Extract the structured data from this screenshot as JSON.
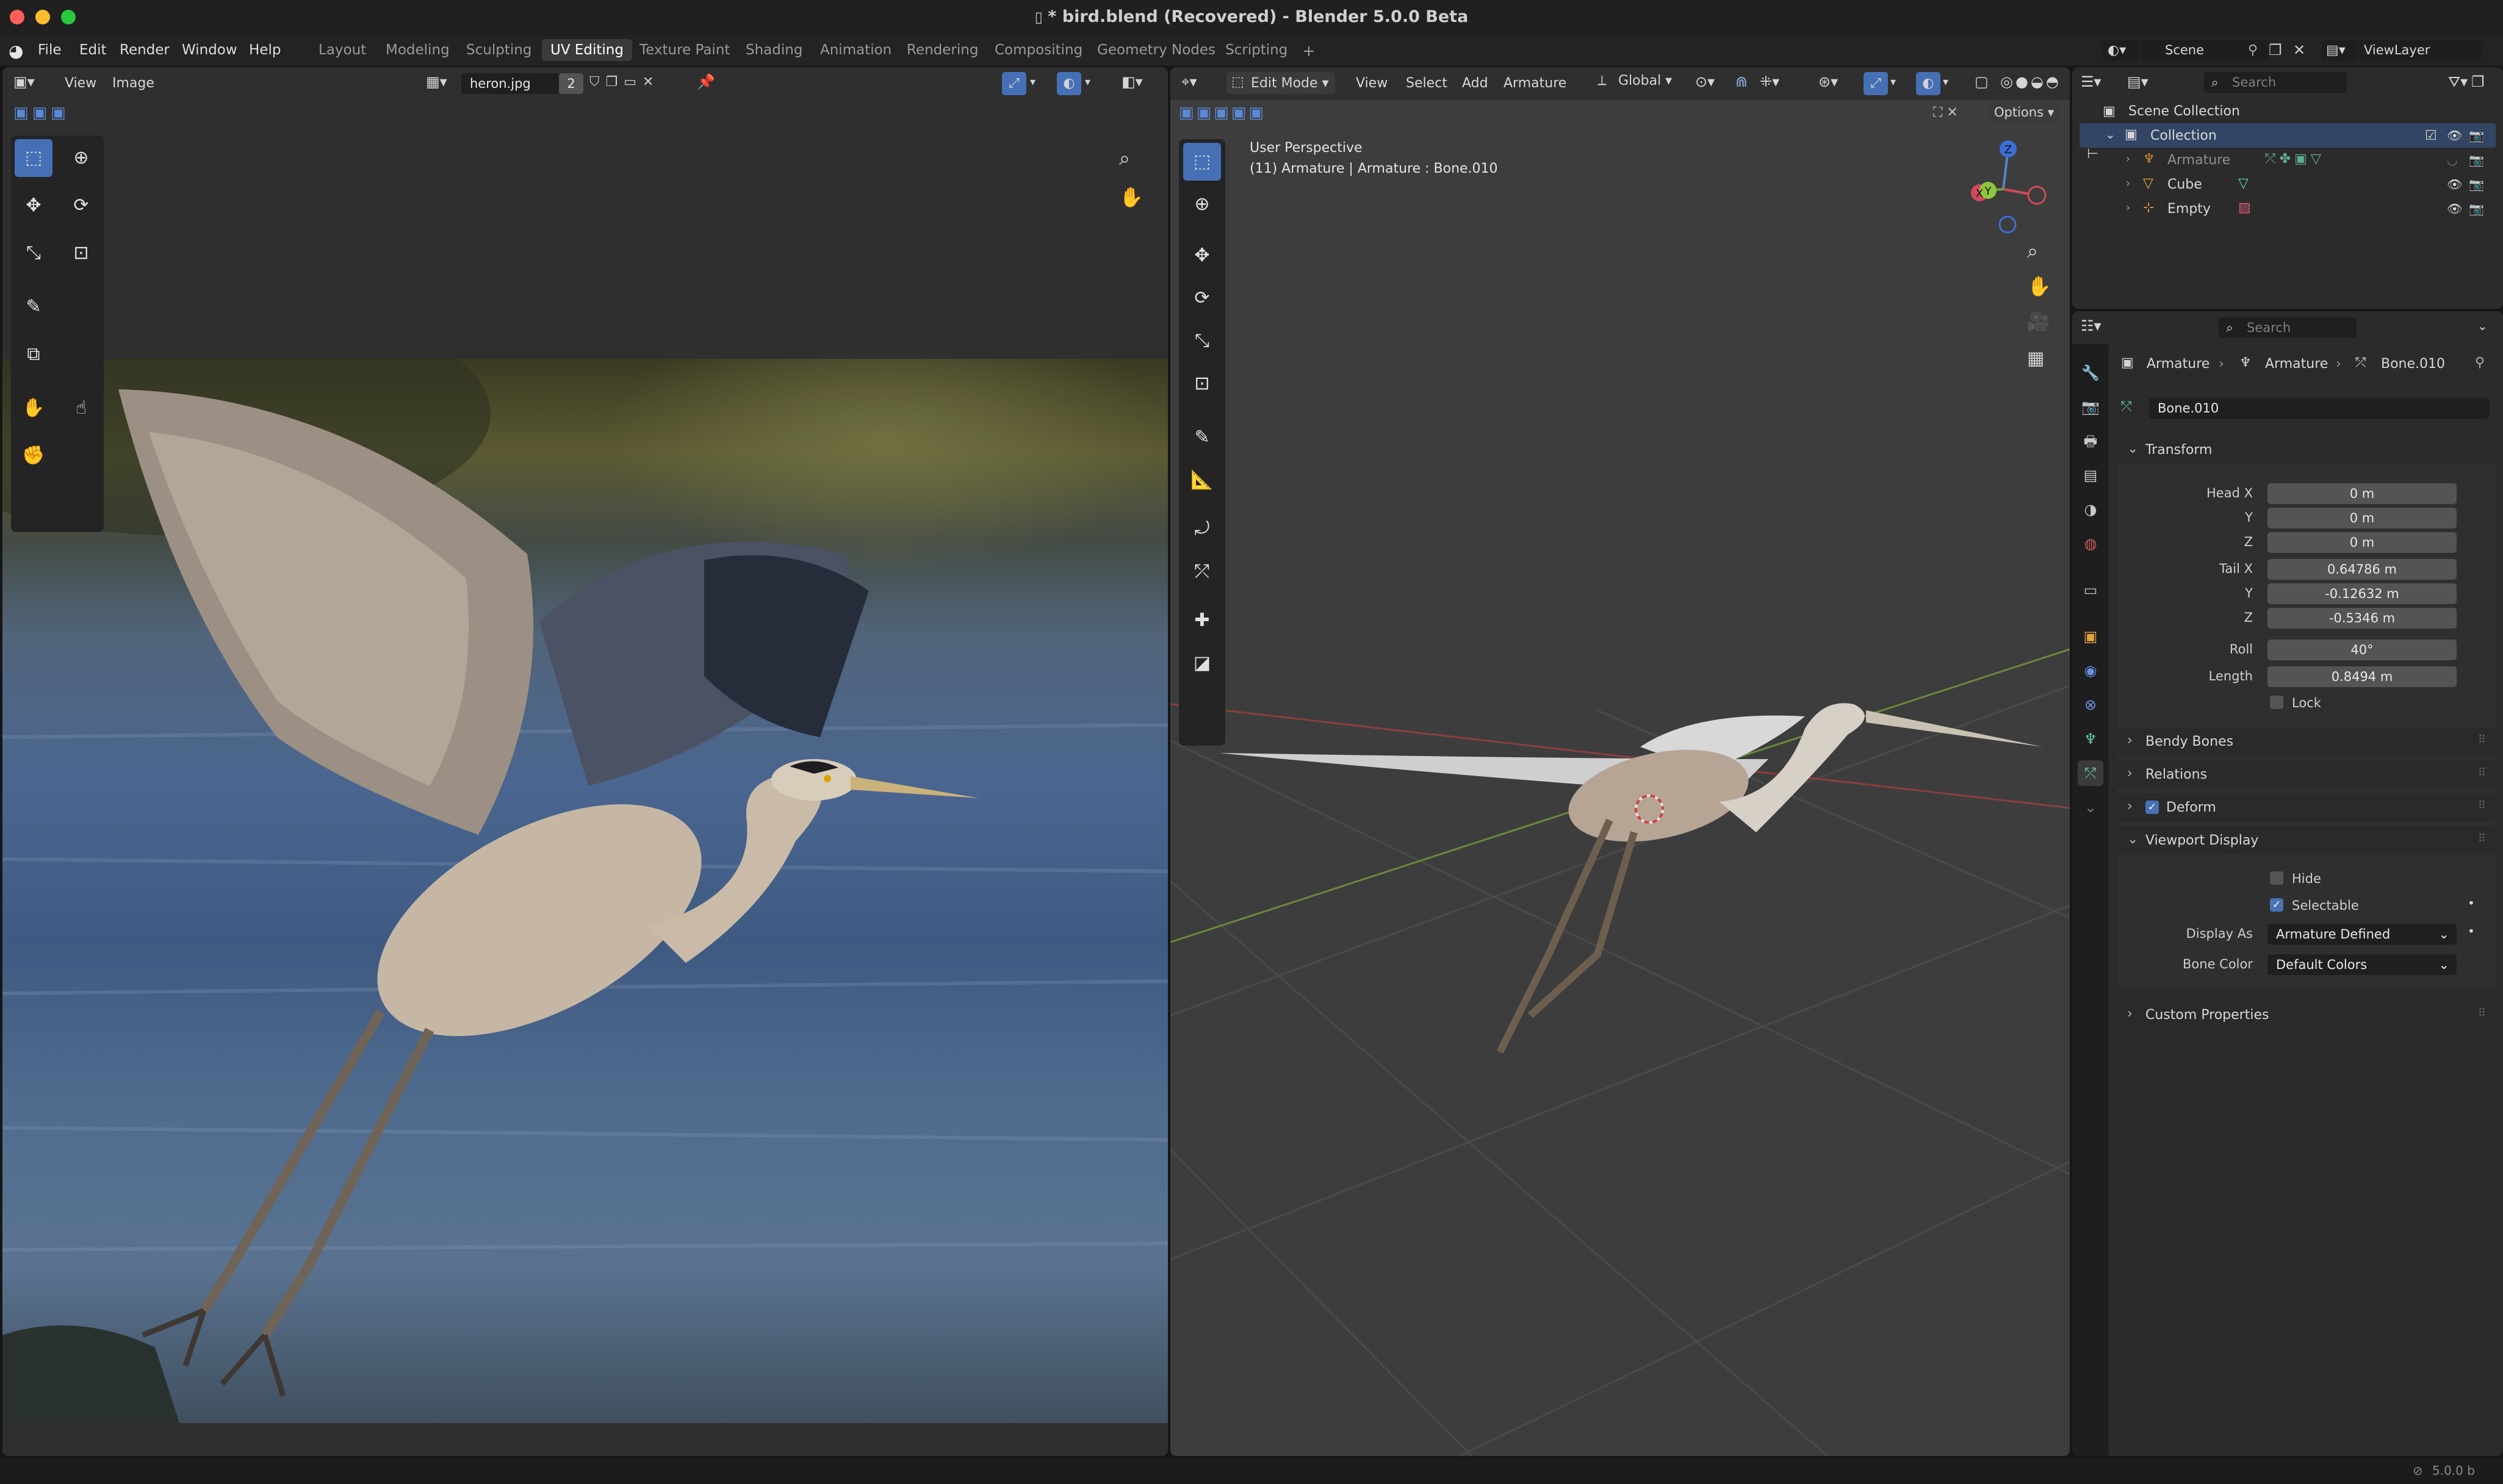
{
  "window": {
    "title": "* bird.blend (Recovered) - Blender 5.0.0 Beta"
  },
  "menubar": {
    "items": [
      "File",
      "Edit",
      "Render",
      "Window",
      "Help"
    ],
    "workspaces": [
      "Layout",
      "Modeling",
      "Sculpting",
      "UV Editing",
      "Texture Paint",
      "Shading",
      "Animation",
      "Rendering",
      "Compositing",
      "Geometry Nodes",
      "Scripting"
    ],
    "add_workspace": "+",
    "scene": "Scene",
    "view_layer": "ViewLayer"
  },
  "uv_editor": {
    "menus": [
      "View",
      "Image"
    ],
    "image_name": "heron.jpg",
    "users_count": "2",
    "tools": [
      "select-box-tool",
      "cursor-tool",
      "move-tool",
      "rotate-tool",
      "scale-tool",
      "transform-tool",
      "annotate-tool",
      "rip-tool",
      "grab-tool",
      "relax-tool",
      "pinch-tool"
    ]
  },
  "viewport": {
    "mode": "Edit Mode",
    "menus": [
      "View",
      "Select",
      "Add",
      "Armature"
    ],
    "orientation": "Global",
    "options_label": "Options",
    "overlay_line1": "User Perspective",
    "overlay_line2": "(11) Armature | Armature : Bone.010",
    "gizmo_axes": [
      "Z",
      "Y",
      "X"
    ]
  },
  "outliner": {
    "search_placeholder": "Search",
    "root": "Scene Collection",
    "collection": "Collection",
    "items": [
      "Armature",
      "Cube",
      "Empty"
    ]
  },
  "properties": {
    "search_placeholder": "Search",
    "breadcrumb": [
      "Armature",
      "Armature",
      "Bone.010"
    ],
    "bone_name": "Bone.010",
    "transform": {
      "title": "Transform",
      "head_x_label": "Head X",
      "head_x": "0 m",
      "head_y_label": "Y",
      "head_y": "0 m",
      "head_z_label": "Z",
      "head_z": "0 m",
      "tail_x_label": "Tail X",
      "tail_x": "0.64786 m",
      "tail_y_label": "Y",
      "tail_y": "-0.12632 m",
      "tail_z_label": "Z",
      "tail_z": "-0.5346 m",
      "roll_label": "Roll",
      "roll": "40°",
      "length_label": "Length",
      "length": "0.8494 m",
      "lock_label": "Lock"
    },
    "panels": {
      "bendy_bones": "Bendy Bones",
      "relations": "Relations",
      "deform": "Deform",
      "viewport_display": "Viewport Display",
      "custom_properties": "Custom Properties"
    },
    "viewport_display": {
      "hide_label": "Hide",
      "selectable_label": "Selectable",
      "display_as_label": "Display As",
      "display_as": "Armature Defined",
      "bone_color_label": "Bone Color",
      "bone_color": "Default Colors"
    }
  },
  "statusbar": {
    "version": "5.0.0 b"
  }
}
